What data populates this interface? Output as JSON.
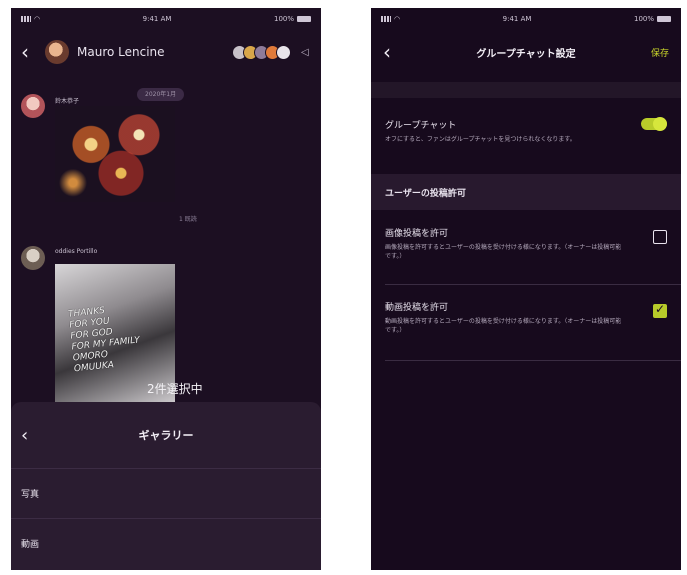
{
  "left_screen": {
    "status": {
      "time": "9:41 AM",
      "battery": "100%"
    },
    "header": {
      "name": "Mauro Lencine"
    },
    "messages": [
      {
        "sender": "鈴木恭子",
        "date": "2020年1月",
        "read": "1 既読"
      },
      {
        "sender": "oddies Portillo"
      }
    ],
    "photo_text": [
      "THANKS",
      "FOR YOU",
      "FOR GOD",
      "FOR MY FAMILY",
      "OMORO",
      "OMUUKA"
    ],
    "selected_count": "2件選択中",
    "sheet": {
      "title": "ギャラリー",
      "items": [
        "写真",
        "動画"
      ]
    }
  },
  "right_screen": {
    "status": {
      "time": "9:41 AM",
      "battery": "100%"
    },
    "header": {
      "title": "グループチャット設定",
      "save": "保存"
    },
    "group_chat": {
      "title": "グループチャット",
      "desc": "オフにすると、ファンはグループチャットを見つけられなくなります。",
      "toggle_on": true
    },
    "section_title": "ユーザーの投稿許可",
    "image_post": {
      "title": "画像投稿を許可",
      "desc": "画像投稿を許可するとユーザーの投稿を受け付ける様になります。（オーナーは投稿可能です。）",
      "checked": false
    },
    "video_post": {
      "title": "動画投稿を許可",
      "desc": "動画投稿を許可するとユーザーの投稿を受け付ける様になります。（オーナーは投稿可能です。）",
      "checked": true
    }
  },
  "colors": {
    "background": "#1c0f22",
    "accent": "#b8cb2a",
    "sheet": "#2a1c30"
  }
}
